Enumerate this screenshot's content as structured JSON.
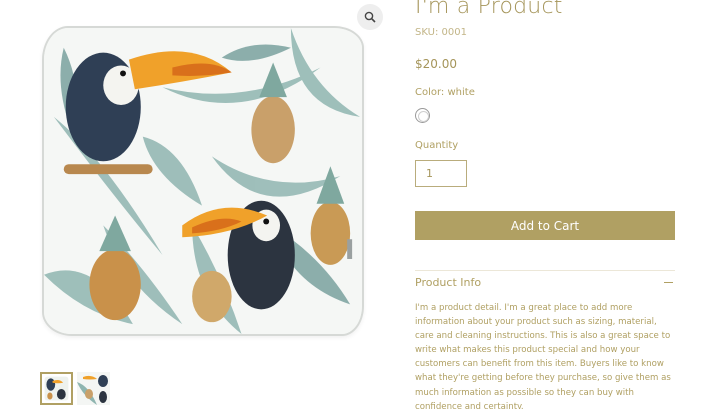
{
  "gallery": {
    "zoom_icon": "magnifier-icon",
    "thumbnails": [
      {
        "name": "pillow-front-thumbnail",
        "selected": true
      },
      {
        "name": "pattern-detail-thumbnail",
        "selected": false
      }
    ]
  },
  "product": {
    "title": "I'm a Product",
    "sku": "SKU: 0001",
    "price": "$20.00",
    "color_label": "Color: white",
    "selected_color": "#ffffff",
    "quantity_label": "Quantity",
    "quantity_value": "1",
    "add_to_cart_label": "Add to Cart",
    "info_section": {
      "title": "Product Info",
      "toggle_icon": "minus-icon",
      "text": "I'm a product detail. I'm a great place to add more information about your product such as sizing, material, care and cleaning instructions. This is also a great space to write what makes this product special and how your customers can benefit from this item. Buyers like to know what they're getting before they purchase, so give them as much information as possible so they can buy with confidence and certainty."
    }
  },
  "colors": {
    "accent": "#b0a063",
    "button_text": "#ffffff"
  }
}
